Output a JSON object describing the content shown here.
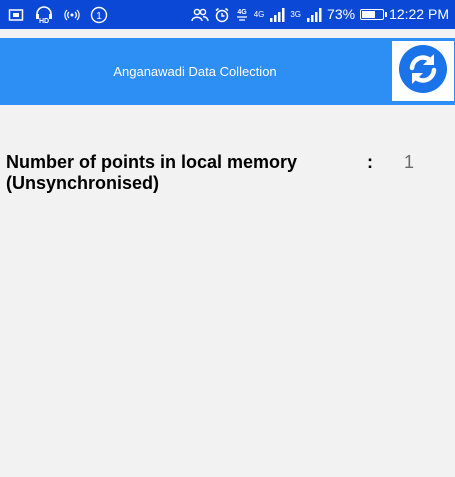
{
  "status_bar": {
    "network_type_4g": "4G",
    "network_type_3g": "3G",
    "battery_percent": "73%",
    "battery_level": 0.73,
    "time": "12:22 PM",
    "icons": [
      "screenshot-icon",
      "hd-voice-icon",
      "hotspot-icon",
      "notification-count-icon",
      "contacts-sync-icon",
      "alarm-icon",
      "volte-icon",
      "signal-4g-icon",
      "signal-3g-icon",
      "battery-icon"
    ],
    "notification_count": "1"
  },
  "app_bar": {
    "title": "Anganawadi Data Collection",
    "sync_icon": "sync-icon",
    "background_color": "#2d8ef3",
    "sync_icon_color": "#1a73e8"
  },
  "main": {
    "points_label": "Number of points in local memory (Unsynchronised)",
    "separator": ":",
    "points_value": "1"
  }
}
